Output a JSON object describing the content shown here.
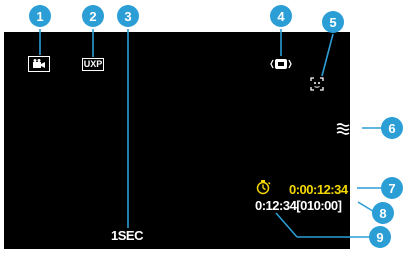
{
  "display": {
    "shutter_speed": "1SEC",
    "recording_time": "0:00:12:34",
    "remaining_time": "0:12:34[010:00]",
    "quality_mode": "UXP",
    "text_yellow": "#f5d800",
    "text_white": "#ffffff"
  },
  "callouts": {
    "color": "#2b9ed6",
    "numbers": [
      "1",
      "2",
      "3",
      "4",
      "5",
      "6",
      "7",
      "8",
      "9"
    ]
  },
  "icons": {
    "mode": "video-camera-icon",
    "quality": "uxp-quality-icon",
    "stabilizer": "image-stabilizer-icon",
    "face": "face-detect-icon",
    "wind": "wind-cut-icon",
    "timer": "self-timer-icon"
  }
}
